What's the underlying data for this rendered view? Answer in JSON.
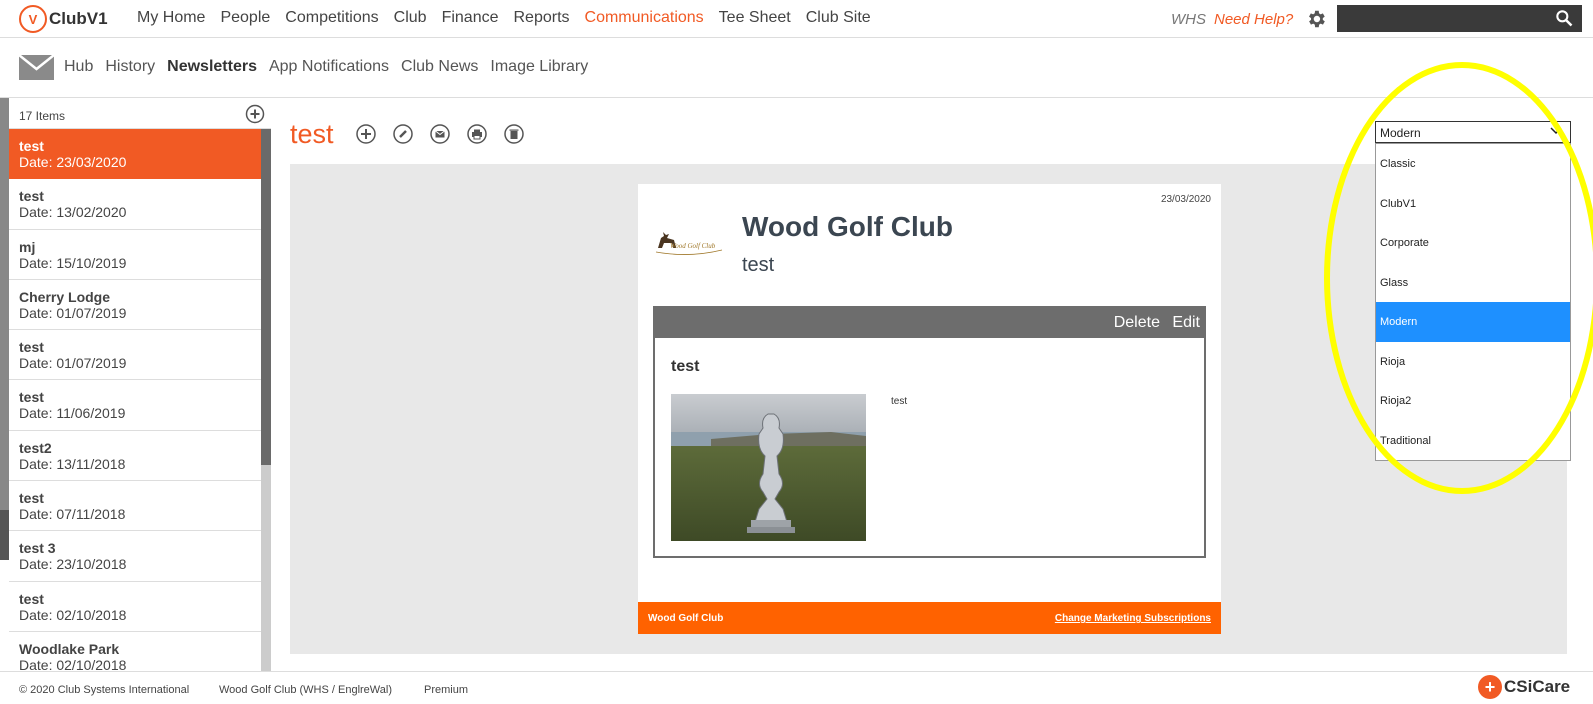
{
  "app": {
    "logo_badge": "V",
    "logo_text": "ClubV1"
  },
  "nav": {
    "items": [
      "My Home",
      "People",
      "Competitions",
      "Club",
      "Finance",
      "Reports",
      "Communications",
      "Tee Sheet",
      "Club Site"
    ],
    "active": "Communications",
    "whs": "WHS",
    "help": "Need Help?",
    "search_placeholder": ""
  },
  "subnav": {
    "items": [
      "Hub",
      "History",
      "Newsletters",
      "App Notifications",
      "Club News",
      "Image Library"
    ],
    "active": "Newsletters"
  },
  "list": {
    "count_label": "17 Items",
    "items": [
      {
        "title": "test",
        "date": "Date: 23/03/2020",
        "selected": true
      },
      {
        "title": "test",
        "date": "Date: 13/02/2020"
      },
      {
        "title": "mj",
        "date": "Date: 15/10/2019"
      },
      {
        "title": "Cherry Lodge",
        "date": "Date: 01/07/2019"
      },
      {
        "title": "test",
        "date": "Date: 01/07/2019"
      },
      {
        "title": "test",
        "date": "Date: 11/06/2019"
      },
      {
        "title": "test2",
        "date": "Date: 13/11/2018"
      },
      {
        "title": "test",
        "date": "Date: 07/11/2018"
      },
      {
        "title": "test 3",
        "date": "Date: 23/10/2018"
      },
      {
        "title": "test",
        "date": "Date: 02/10/2018"
      },
      {
        "title": "Woodlake Park",
        "date": "Date: 02/10/2018"
      }
    ]
  },
  "main": {
    "title": "test"
  },
  "newsletter": {
    "date": "23/03/2020",
    "logo_text": "Wood Golf Club",
    "club_name": "Wood Golf Club",
    "subtitle": "test",
    "article": {
      "delete_label": "Delete",
      "edit_label": "Edit",
      "heading": "test",
      "body": "test"
    },
    "footer_left": "Wood Golf Club",
    "footer_right": "Change Marketing Subscriptions"
  },
  "template_select": {
    "value": "Modern",
    "options": [
      "Classic",
      "ClubV1",
      "Corporate",
      "Glass",
      "Modern",
      "Rioja",
      "Rioja2",
      "Traditional"
    ],
    "selected": "Modern"
  },
  "footer": {
    "copyright": "© 2020 Club Systems International",
    "club": "Wood Golf Club (WHS / EnglreWal)",
    "tier": "Premium",
    "brand_text": "CSiCare"
  },
  "colors": {
    "accent": "#f15a24",
    "footer_bar": "#ff6200",
    "highlight": "#ffff00",
    "selected_option": "#1e90ff"
  }
}
